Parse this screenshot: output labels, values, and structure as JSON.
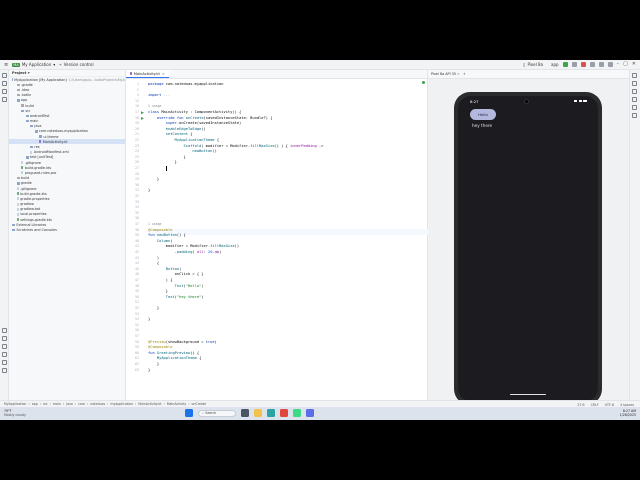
{
  "titlebar": {
    "project_badge": "MA",
    "project_name": "My Application",
    "vcs": "Version control",
    "run_config": "Pixel 8a",
    "app_label": "app"
  },
  "project_panel": {
    "header": "Project",
    "items": [
      {
        "label": "MyApplication [My Application]",
        "hint": "C:\\Users\\gulp...tudioProjects\\MyA",
        "kind": "folder",
        "indent": 0
      },
      {
        "label": ".gradle",
        "kind": "folder-gray",
        "indent": 1
      },
      {
        "label": ".idea",
        "kind": "folder-gray",
        "indent": 1
      },
      {
        "label": ".kotlin",
        "kind": "folder-gray",
        "indent": 1
      },
      {
        "label": "app",
        "kind": "folder",
        "indent": 1
      },
      {
        "label": "build",
        "kind": "folder-gray",
        "indent": 2
      },
      {
        "label": "src",
        "kind": "folder",
        "indent": 2
      },
      {
        "label": "androidTest",
        "kind": "folder",
        "indent": 3
      },
      {
        "label": "main",
        "kind": "folder",
        "indent": 3
      },
      {
        "label": "java",
        "kind": "folder",
        "indent": 4
      },
      {
        "label": "com.noteduas.myapplication",
        "kind": "folder",
        "indent": 5
      },
      {
        "label": "ui.theme",
        "kind": "folder",
        "indent": 6
      },
      {
        "label": "MainActivity.kt",
        "kind": "kt",
        "indent": 6,
        "selected": true
      },
      {
        "label": "res",
        "kind": "folder",
        "indent": 4
      },
      {
        "label": "AndroidManifest.xml",
        "kind": "file",
        "indent": 4
      },
      {
        "label": "test [unitTest]",
        "kind": "folder",
        "indent": 3
      },
      {
        "label": ".gitignore",
        "kind": "file",
        "indent": 2
      },
      {
        "label": "build.gradle.kts",
        "kind": "gr",
        "indent": 2
      },
      {
        "label": "proguard-rules.pro",
        "kind": "file",
        "indent": 2
      },
      {
        "label": "build",
        "kind": "folder-gray",
        "indent": 1
      },
      {
        "label": "gradle",
        "kind": "folder",
        "indent": 1
      },
      {
        "label": ".gitignore",
        "kind": "file",
        "indent": 1
      },
      {
        "label": "build.gradle.kts",
        "kind": "gr",
        "indent": 1
      },
      {
        "label": "gradle.properties",
        "kind": "file",
        "indent": 1
      },
      {
        "label": "gradlew",
        "kind": "file",
        "indent": 1
      },
      {
        "label": "gradlew.bat",
        "kind": "file",
        "indent": 1
      },
      {
        "label": "local.properties",
        "kind": "file",
        "indent": 1
      },
      {
        "label": "settings.gradle.kts",
        "kind": "gr",
        "indent": 1
      },
      {
        "label": "External Libraries",
        "kind": "folder",
        "indent": 0
      },
      {
        "label": "Scratches and Consoles",
        "kind": "folder",
        "indent": 0
      }
    ]
  },
  "editor": {
    "tab": "MainActivity.kt",
    "lines": [
      {
        "n": "1",
        "html": "<span class=\"kw\">package</span> com.noteduas.myapplication"
      },
      {
        "n": "2",
        "html": ""
      },
      {
        "n": "3",
        "html": "<span class=\"kw\">import</span> <span class=\"cm\">...</span>"
      },
      {
        "n": "15",
        "html": ""
      },
      {
        "n": "16",
        "html": "<span class=\"hint\">1 usage</span>"
      },
      {
        "n": "17",
        "html": "<span class=\"kw\">class</span> MainActivity : ComponentActivity() {"
      },
      {
        "n": "18",
        "html": "    <span class=\"kw\">override fun</span> <span class=\"fn\">onCreate</span>(savedInstanceState: Bundle?) {"
      },
      {
        "n": "19",
        "html": "        <span class=\"kw\">super</span>.onCreate(savedInstanceState)"
      },
      {
        "n": "20",
        "html": "        <span class=\"fn\">enableEdgeToEdge</span>()"
      },
      {
        "n": "21",
        "html": "        <span class=\"fn\">setContent</span> {"
      },
      {
        "n": "22",
        "html": "            <span class=\"fn\">MyApplicationTheme</span> {"
      },
      {
        "n": "23",
        "html": "                <span class=\"fn\">Scaffold</span>( modifier = Modifier.<span class=\"fn\">fillMaxSize</span>() ) { <span class=\"pm\">innerPadding</span> ->"
      },
      {
        "n": "24",
        "html": "                    <span class=\"fn\">newButton</span>()"
      },
      {
        "n": "25",
        "html": "                }"
      },
      {
        "n": "26",
        "html": "            }"
      },
      {
        "n": "27",
        "html": "        <span class=\"caret\"></span>"
      },
      {
        "n": "28",
        "html": ""
      },
      {
        "n": "29",
        "html": "    }"
      },
      {
        "n": "30",
        "html": ""
      },
      {
        "n": "31",
        "html": "}"
      },
      {
        "n": "32",
        "html": ""
      },
      {
        "n": "33",
        "html": ""
      },
      {
        "n": "34",
        "html": ""
      },
      {
        "n": "35",
        "html": ""
      },
      {
        "n": "36",
        "html": ""
      },
      {
        "n": "37",
        "html": "<span class=\"hint\">1 usage</span>"
      },
      {
        "n": "38",
        "html": "<span class=\"an\">@Composable</span>"
      },
      {
        "n": "39",
        "html": "<span class=\"kw\">fun</span> <span class=\"fn\">newButton</span>() {"
      },
      {
        "n": "40",
        "html": "    <span class=\"fn\">Column</span>("
      },
      {
        "n": "41",
        "html": "        modifier = Modifier.<span class=\"fn\">fillMaxSize</span>()"
      },
      {
        "n": "42",
        "html": "            .<span class=\"fn\">padding</span>( <span class=\"pm\">all:</span> <span class=\"nm\">20</span>.<span class=\"pm\">dp</span>)"
      },
      {
        "n": "43",
        "html": "    )"
      },
      {
        "n": "44",
        "html": "    {"
      },
      {
        "n": "45",
        "html": "        <span class=\"fn\">Button</span>("
      },
      {
        "n": "46",
        "html": "            onClick = { }"
      },
      {
        "n": "47",
        "html": "        ) {"
      },
      {
        "n": "48",
        "html": "            <span class=\"fn\">Text</span>(<span class=\"st\">\"Hello\"</span>)"
      },
      {
        "n": "49",
        "html": "        }"
      },
      {
        "n": "50",
        "html": "        <span class=\"fn\">Text</span>(<span class=\"st\">\"hey there\"</span>)"
      },
      {
        "n": "51",
        "html": ""
      },
      {
        "n": "52",
        "html": "    }"
      },
      {
        "n": "53",
        "html": ""
      },
      {
        "n": "54",
        "html": "}"
      },
      {
        "n": "55",
        "html": ""
      },
      {
        "n": "56",
        "html": ""
      },
      {
        "n": "57",
        "html": ""
      },
      {
        "n": "58",
        "html": "<span class=\"an\">@Preview</span>(showBackground = <span class=\"kw\">true</span>)"
      },
      {
        "n": "59",
        "html": "<span class=\"an\">@Composable</span>"
      },
      {
        "n": "60",
        "html": "<span class=\"kw\">fun</span> <span class=\"fn\">GreetingPreview</span>() {"
      },
      {
        "n": "61",
        "html": "    <span class=\"fn\">MyApplicationTheme</span> {"
      },
      {
        "n": "62",
        "html": "    }"
      },
      {
        "n": "63",
        "html": "}"
      }
    ]
  },
  "preview": {
    "tab_label": "Pixel 8a API 35",
    "time": "8:27",
    "button_label": "Hello",
    "text": "hey there"
  },
  "status": {
    "breadcrumb": [
      "MyApplication",
      "app",
      "src",
      "main",
      "java",
      "com",
      "noteduas",
      "myapplication",
      "MainActivity.kt",
      "MainActivity",
      "onCreate"
    ],
    "position": "27:9",
    "encoding": "UTF-8",
    "indent": "4 spaces",
    "line_sep": "CRLF"
  },
  "taskbar": {
    "weather_temp": "79°F",
    "weather_label": "Mostly cloudy",
    "search_placeholder": "Search",
    "time": "8:27 AM",
    "date": "1/28/2025"
  }
}
